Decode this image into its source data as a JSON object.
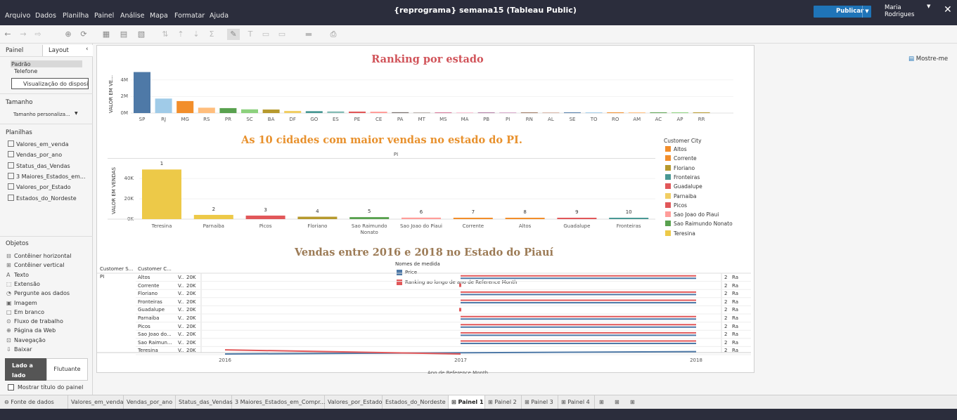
{
  "titlebar": {
    "menu": [
      "Arquivo",
      "Dados",
      "Planilha",
      "Painel",
      "Análise",
      "Mapa",
      "Formatar",
      "Ajuda"
    ],
    "title": "{reprograma} semana15 (Tableau Public)",
    "publish_label": "Publicar",
    "user_name": "Maria Rodrigues",
    "close": "✕"
  },
  "toolbar": {
    "show_me": "Mostre-me"
  },
  "left_panel": {
    "tab_panel": "Painel",
    "tab_layout": "Layout",
    "collapse": "‹",
    "device_default": "Padrão",
    "device_phone": "Telefone",
    "device_preview_button": "Visualização do dispositivo",
    "size_header": "Tamanho",
    "size_value": "Tamanho personaliza...",
    "sheets_header": "Planilhas",
    "sheets": [
      "Valores_em_venda",
      "Vendas_por_ano",
      "Status_das_Vendas",
      "3 Maiores_Estados_em...",
      "Valores_por_Estado",
      "Estados_do_Nordeste"
    ],
    "objects_header": "Objetos",
    "objects": [
      {
        "label": "Contêiner horizontal",
        "icon": "horizontal-container-icon",
        "glyph": "⊟"
      },
      {
        "label": "Contêiner vertical",
        "icon": "vertical-container-icon",
        "glyph": "⊞"
      },
      {
        "label": "Texto",
        "icon": "text-icon",
        "glyph": "A"
      },
      {
        "label": "Extensão",
        "icon": "extension-icon",
        "glyph": "⬚"
      },
      {
        "label": "Pergunte aos dados",
        "icon": "ask-data-icon",
        "glyph": "◔"
      },
      {
        "label": "Imagem",
        "icon": "image-icon",
        "glyph": "▣"
      },
      {
        "label": "Em branco",
        "icon": "blank-icon",
        "glyph": "□"
      },
      {
        "label": "Fluxo de trabalho",
        "icon": "workflow-icon",
        "glyph": "⊙"
      },
      {
        "label": "Página da Web",
        "icon": "web-page-icon",
        "glyph": "⊕"
      },
      {
        "label": "Navegação",
        "icon": "navigation-icon",
        "glyph": "⊡"
      },
      {
        "label": "Baixar",
        "icon": "download-icon",
        "glyph": "⇩"
      }
    ],
    "tiled_button": "Lado a lado",
    "floating_button": "Flutuante",
    "show_title": "Mostrar título do painel"
  },
  "colors": {
    "accent_blue": "#4e79a7",
    "accent_red": "#e15759",
    "title_red": "#d1545a",
    "title_orange": "#e8912d",
    "title_brown": "#9c7b56"
  },
  "chart_data": [
    {
      "type": "bar",
      "title": "Ranking por estado",
      "ylabel": "VALOR EM VE...",
      "yticks": [
        "4M",
        "2M",
        "0M"
      ],
      "ylim": [
        0,
        5000000
      ],
      "categories": [
        "SP",
        "RJ",
        "MG",
        "RS",
        "PR",
        "SC",
        "BA",
        "DF",
        "GO",
        "ES",
        "PE",
        "CE",
        "PA",
        "MT",
        "MS",
        "MA",
        "PB",
        "PI",
        "RN",
        "AL",
        "SE",
        "TO",
        "RO",
        "AM",
        "AC",
        "AP",
        "RR"
      ],
      "values": [
        4950000,
        1750000,
        1450000,
        650000,
        600000,
        450000,
        430000,
        260000,
        230000,
        200000,
        180000,
        170000,
        100000,
        90000,
        50000,
        45000,
        40000,
        30000,
        25000,
        20000,
        15000,
        10000,
        8000,
        5000,
        3000,
        2000,
        1000
      ],
      "colors": [
        "#4e79a7",
        "#a0cbe8",
        "#f28e2b",
        "#ffbe7d",
        "#59a14f",
        "#8cd17d",
        "#b6992d",
        "#f1ce63",
        "#499894",
        "#86bcb6",
        "#e15759",
        "#ff9d9a",
        "#79706e",
        "#bab0ac",
        "#d37295",
        "#fabfd2",
        "#b07aa1",
        "#d4a6c8",
        "#9d7660",
        "#d7b5a6",
        "#4e79a7",
        "#a0cbe8",
        "#f28e2b",
        "#ffbe7d",
        "#59a14f",
        "#8cd17d",
        "#b6992d"
      ]
    },
    {
      "type": "bar",
      "title": "As 10 cidades com maior vendas no estado do PI.",
      "panel_header": "PI",
      "ylabel": "VALOR EM VENDAS",
      "yticks": [
        "40K",
        "20K",
        "0K"
      ],
      "ylim": [
        0,
        52000
      ],
      "categories": [
        "Teresina",
        "Parnaiba",
        "Picos",
        "Floriano",
        "Sao Raimundo Nonato",
        "Sao Joao do Piaui",
        "Corrente",
        "Altos",
        "Guadalupe",
        "Fronteiras"
      ],
      "ranks": [
        "1",
        "2",
        "3",
        "4",
        "5",
        "6",
        "7",
        "8",
        "9",
        "10"
      ],
      "values": [
        49000,
        4200,
        3500,
        2400,
        2000,
        1500,
        1400,
        1300,
        1200,
        1100
      ],
      "colors": [
        "#edc948",
        "#edc948",
        "#e15759",
        "#b6992d",
        "#59a14f",
        "#ff9d9a",
        "#f28e2b",
        "#f28e2b",
        "#e15759",
        "#499894"
      ],
      "legend_title": "Customer City",
      "legend": [
        {
          "name": "Altos",
          "color": "#f28e2b"
        },
        {
          "name": "Corrente",
          "color": "#f28e2b"
        },
        {
          "name": "Floriano",
          "color": "#b6992d"
        },
        {
          "name": "Fronteiras",
          "color": "#499894"
        },
        {
          "name": "Guadalupe",
          "color": "#e15759"
        },
        {
          "name": "Parnaiba",
          "color": "#f1ce63"
        },
        {
          "name": "Picos",
          "color": "#e15759"
        },
        {
          "name": "Sao Joao do Piaui",
          "color": "#ff9d9a"
        },
        {
          "name": "Sao Raimundo Nonato",
          "color": "#59a14f"
        },
        {
          "name": "Teresina",
          "color": "#edc948"
        }
      ]
    },
    {
      "type": "line",
      "title": "Vendas entre 2016 e 2018 no Estado do Piauí",
      "col_header_state": "Customer S...",
      "col_header_city": "Customer C...",
      "state": "PI",
      "cities": [
        "Altos",
        "Corrente",
        "Floriano",
        "Fronteiras",
        "Guadalupe",
        "Parnaiba",
        "Picos",
        "Sao Joao do...",
        "Sao Raimun...",
        "Teresina"
      ],
      "row_axis_tick": "20K",
      "row_axis_label": "V..",
      "right_value": "2",
      "right_label": "Ra",
      "x": [
        "2016",
        "2017",
        "2018"
      ],
      "legend_title": "Nomes de medida",
      "series": [
        {
          "name": "Price",
          "color": "#4e79a7"
        },
        {
          "name": "Ranking ao longo de ano de Reference Month",
          "color": "#e15759"
        }
      ],
      "xlabel": "Ano de Reference Month"
    }
  ],
  "bottom_tabs": {
    "datasource": "Fonte de dados",
    "tabs": [
      "Valores_em_venda",
      "Vendas_por_ano",
      "Status_das_Vendas",
      "3 Maiores_Estados_em_Compr...",
      "Valores_por_Estado",
      "Estados_do_Nordeste"
    ],
    "dashboards": [
      "Painel 1",
      "Painel 2",
      "Painel 3",
      "Painel 4"
    ],
    "active": "Painel 1"
  }
}
